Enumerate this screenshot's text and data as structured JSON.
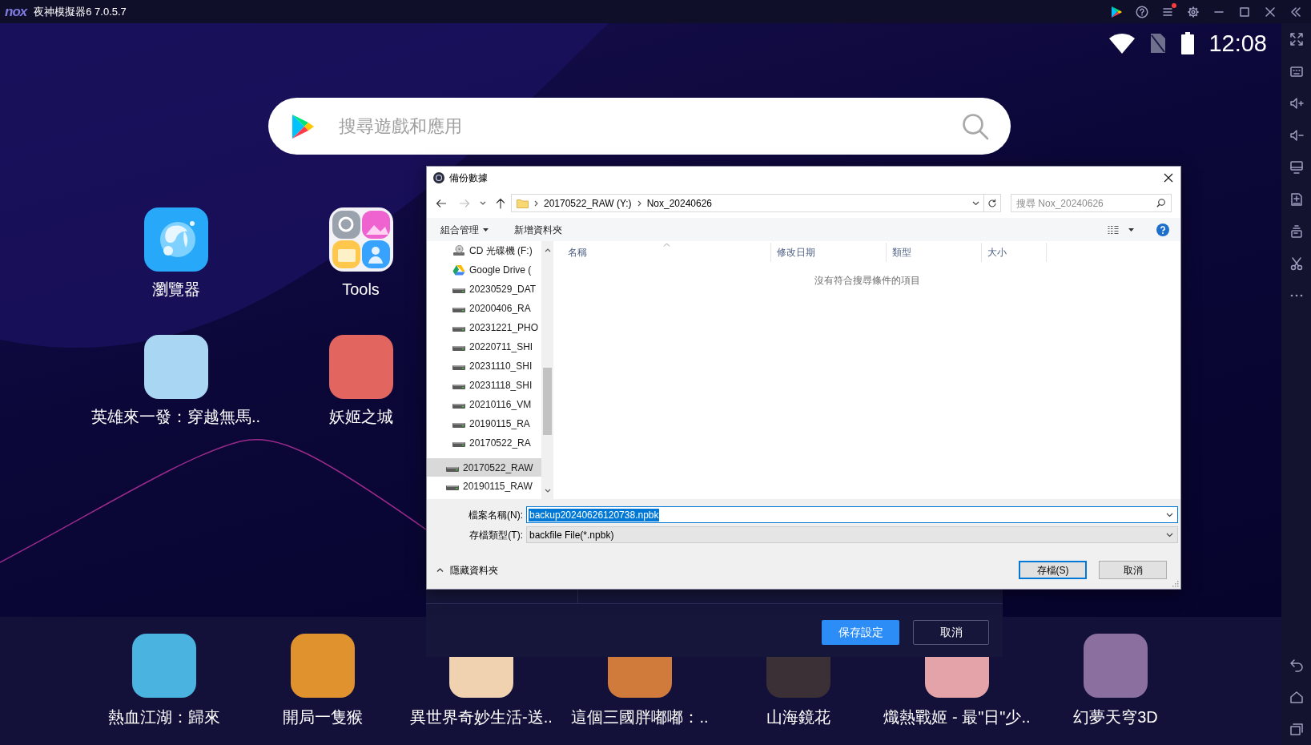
{
  "title_bar": {
    "logo": "nox",
    "title": "夜神模擬器6 7.0.5.7",
    "menu_notification": true
  },
  "status_bar": {
    "time": "12:08"
  },
  "search_bar": {
    "placeholder": "搜尋遊戲和應用"
  },
  "home_apps": [
    {
      "label": "瀏覽器",
      "kind": "browser"
    },
    {
      "label": "Tools",
      "kind": "folder"
    },
    {
      "label": "英雄來一發：穿越無馬..",
      "kind": "game",
      "color": "#a9d6f2"
    },
    {
      "label": "妖姬之城",
      "kind": "game",
      "color": "#e2665f"
    }
  ],
  "dock_apps": [
    {
      "label": "熱血江湖：歸來",
      "color": "#4bb3e0"
    },
    {
      "label": "開局一隻猴",
      "color": "#e0922f"
    },
    {
      "label": "異世界奇妙生活-送..",
      "color": "#f0d2b0"
    },
    {
      "label": "這個三國胖嘟嘟：..",
      "color": "#d07a3c"
    },
    {
      "label": "山海鏡花",
      "color": "#3b3036"
    },
    {
      "label": "熾熱戰姬 - 最\"日\"少..",
      "color": "#e3a3a8"
    },
    {
      "label": "幻夢天穹3D",
      "color": "#8b6f9e"
    }
  ],
  "settings_dialog": {
    "buttons": [
      {
        "label": "保存設定",
        "kind": "primary"
      },
      {
        "label": "取消",
        "kind": "secondary"
      }
    ]
  },
  "file_dialog": {
    "title": "備份數據",
    "navigation": {
      "back_disabled": false,
      "forward_disabled": true
    },
    "address_path": [
      "20170522_RAW (Y:)",
      "Nox_20240626"
    ],
    "search_placeholder": "搜尋 Nox_20240626",
    "toolbar": [
      {
        "label": "組合管理",
        "has_menu": true
      },
      {
        "label": "新增資料夾",
        "has_menu": false
      }
    ],
    "navigation_pane": [
      {
        "indented": true,
        "items": [
          {
            "label": "CD 光碟機 (F:)",
            "kind": "cd",
            "selected": false
          },
          {
            "label": "Google Drive (",
            "kind": "cloud",
            "selected": false
          },
          {
            "label": "20230529_DAT",
            "kind": "drive",
            "selected": false
          },
          {
            "label": "20200406_RA",
            "kind": "drive",
            "selected": false
          },
          {
            "label": "20231221_PHO",
            "kind": "drive",
            "selected": false
          },
          {
            "label": "20220711_SHI",
            "kind": "drive",
            "selected": false
          },
          {
            "label": "20231110_SHI",
            "kind": "drive",
            "selected": false
          },
          {
            "label": "20231118_SHI",
            "kind": "drive",
            "selected": false
          },
          {
            "label": "20210116_VM",
            "kind": "drive",
            "selected": false
          },
          {
            "label": "20190115_RA",
            "kind": "drive",
            "selected": false
          },
          {
            "label": "20170522_RA",
            "kind": "drive",
            "selected": false
          }
        ]
      },
      {
        "indented": false,
        "items": [
          {
            "label": "20170522_RAW",
            "kind": "drive",
            "selected": true
          },
          {
            "label": "20190115_RAW",
            "kind": "drive",
            "selected": false
          }
        ]
      }
    ],
    "columns": [
      {
        "label": "名稱",
        "sorted": true
      },
      {
        "label": "修改日期",
        "sorted": false
      },
      {
        "label": "類型",
        "sorted": false
      },
      {
        "label": "大小",
        "sorted": false
      }
    ],
    "empty_message": "沒有符合搜尋條件的項目",
    "file_name": {
      "label": "檔案名稱(N):",
      "value": "backup20240626120738.npbk",
      "text_selected": true
    },
    "save_as_type": {
      "label": "存檔類型(T):",
      "value": "backfile File(*.npbk)"
    },
    "hide_folders": "隱藏資料夾",
    "buttons": [
      {
        "label": "存檔(S)",
        "default": true
      },
      {
        "label": "取消",
        "default": false
      }
    ]
  }
}
